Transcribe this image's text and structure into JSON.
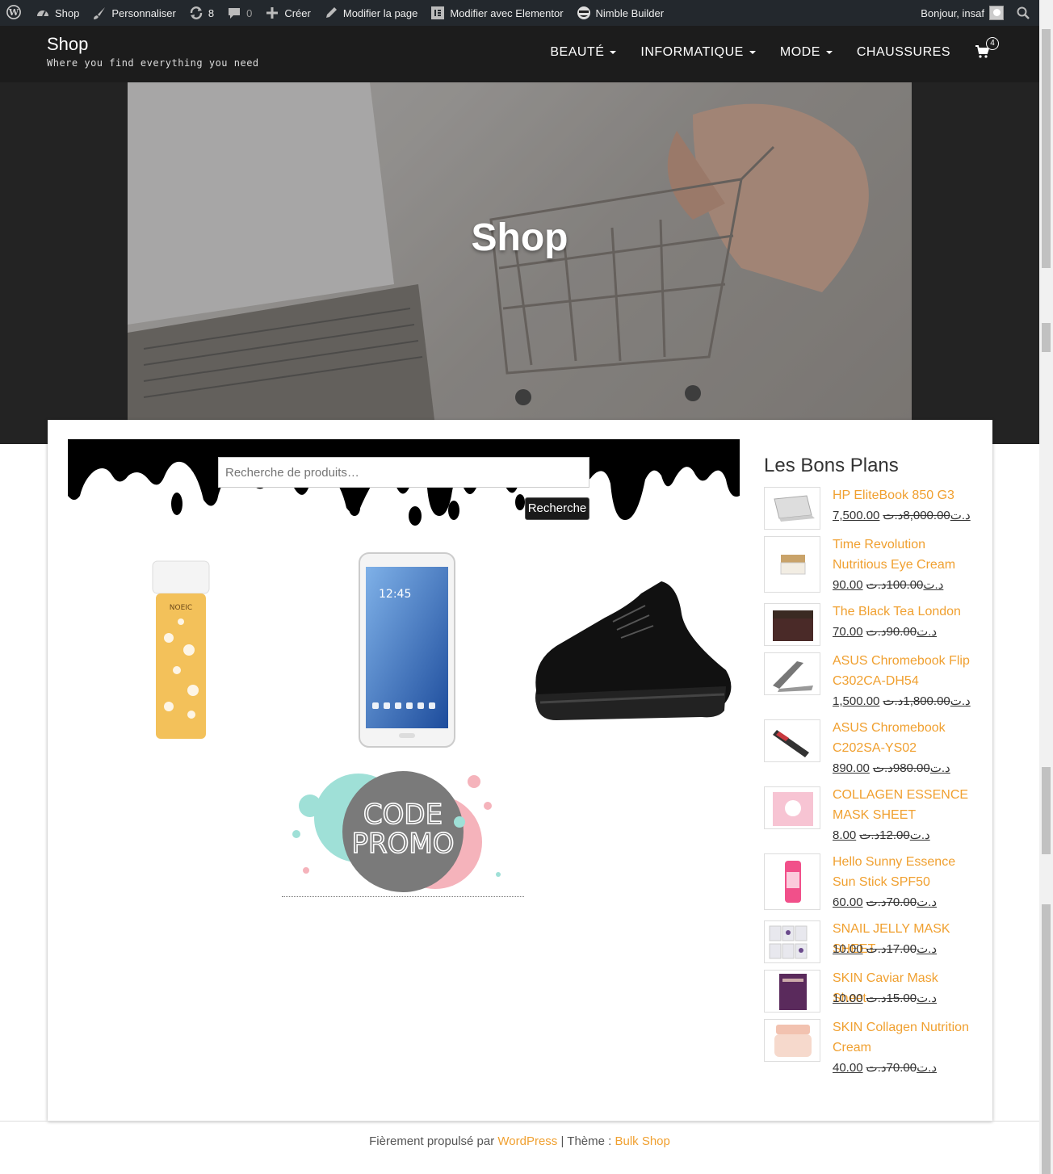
{
  "adminbar": {
    "site": "Shop",
    "customize": "Personnaliser",
    "updates": "8",
    "comments": "0",
    "new": "Créer",
    "edit_page": "Modifier la page",
    "edit_elementor": "Modifier avec Elementor",
    "nimble": "Nimble Builder",
    "greeting": "Bonjour, insaf"
  },
  "header": {
    "title": "Shop",
    "description": "Where you find everything you need",
    "nav": [
      "BEAUTÉ",
      "INFORMATIQUE",
      "MODE",
      "CHAUSSURES"
    ],
    "cart_count": "4"
  },
  "hero": {
    "title": "Shop"
  },
  "search": {
    "placeholder": "Recherche de produits…",
    "button": "Recherche"
  },
  "products": [
    {
      "name": "Real Floral toner",
      "label": "NOEIC"
    },
    {
      "name": "Samsung Galaxy Tab",
      "label": "12:45"
    },
    {
      "name": "Buffalo sneakers",
      "label": ""
    }
  ],
  "promo": {
    "line1": "CODE",
    "line2": "PROMO"
  },
  "sidebar": {
    "title": "Les Bons Plans",
    "deals": [
      {
        "name": "HP EliteBook 850 G3",
        "price": "7,500.00د.ت",
        "old": "8,000.00د.ت"
      },
      {
        "name": "Time Revolution Nutritious Eye Cream",
        "price": "90.00د.ت",
        "old": "100.00د.ت"
      },
      {
        "name": "The Black Tea London",
        "price": "70.00د.ت",
        "old": "90.00د.ت"
      },
      {
        "name": "ASUS Chromebook Flip C302CA-DH54",
        "price": "1,500.00د.ت",
        "old": "1,800.00د.ت"
      },
      {
        "name": "ASUS Chromebook C202SA-YS02",
        "price": "890.00د.ت",
        "old": "980.00د.ت"
      },
      {
        "name": "COLLAGEN ESSENCE MASK SHEET",
        "price": "8.00د.ت",
        "old": "12.00د.ت"
      },
      {
        "name": "Hello Sunny Essence Sun Stick SPF50",
        "price": "60.00د.ت",
        "old": "70.00د.ت"
      },
      {
        "name": "SNAIL JELLY MASK SHEET",
        "price": "10.00د.ت",
        "old": "17.00د.ت"
      },
      {
        "name": "SKIN Caviar Mask Sheet",
        "price": "10.00د.ت",
        "old": "15.00د.ت"
      },
      {
        "name": "SKIN Collagen Nutrition Cream",
        "price": "40.00د.ت",
        "old": "70.00د.ت"
      }
    ]
  },
  "footer": {
    "prefix": "Fièrement propulsé par",
    "wp": "WordPress",
    "sep": "| Thème :",
    "theme": "Bulk Shop"
  },
  "colors": {
    "accent": "#f0a030",
    "header": "#1c1c1c",
    "adminbar": "#23282d"
  }
}
